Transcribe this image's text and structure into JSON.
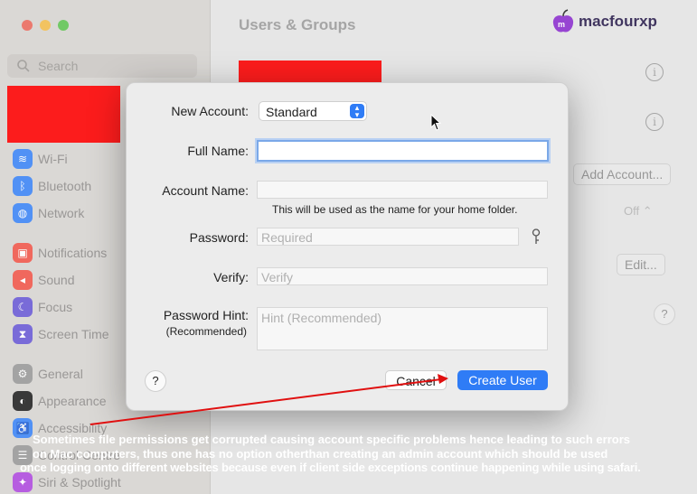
{
  "sidebar": {
    "search_placeholder": "Search",
    "items": [
      {
        "label": "Wi-Fi",
        "icon": "wifi-icon",
        "color": "#3d86f7"
      },
      {
        "label": "Bluetooth",
        "icon": "bluetooth-icon",
        "color": "#3d86f7"
      },
      {
        "label": "Network",
        "icon": "globe-icon",
        "color": "#3d86f7"
      },
      {
        "label": "Notifications",
        "icon": "bell-icon",
        "color": "#f2574a"
      },
      {
        "label": "Sound",
        "icon": "speaker-icon",
        "color": "#f2574a"
      },
      {
        "label": "Focus",
        "icon": "moon-icon",
        "color": "#6a5bd6"
      },
      {
        "label": "Screen Time",
        "icon": "hourglass-icon",
        "color": "#6a5bd6"
      },
      {
        "label": "General",
        "icon": "gear-icon",
        "color": "#9a9a9a"
      },
      {
        "label": "Appearance",
        "icon": "appearance-icon",
        "color": "#222222"
      },
      {
        "label": "Accessibility",
        "icon": "accessibility-icon",
        "color": "#3d86f7"
      },
      {
        "label": "Control Centre",
        "icon": "control-centre-icon",
        "color": "#9a9a9a"
      },
      {
        "label": "Siri & Spotlight",
        "icon": "siri-icon",
        "color": "#b04be0"
      }
    ]
  },
  "main": {
    "title": "Users & Groups",
    "add_account_label": "Add Account...",
    "off_label": "Off",
    "edit_label": "Edit...",
    "help_label": "?"
  },
  "brand": {
    "name": "macfourxp"
  },
  "sheet": {
    "new_account_label": "New Account:",
    "account_type": "Standard",
    "full_name_label": "Full Name:",
    "full_name_value": "",
    "account_name_label": "Account Name:",
    "account_name_value": "",
    "account_name_hint": "This will be used as the name for your home folder.",
    "password_label": "Password:",
    "password_placeholder": "Required",
    "verify_label": "Verify:",
    "verify_placeholder": "Verify",
    "password_hint_label": "Password Hint:",
    "password_hint_sublabel": "(Recommended)",
    "password_hint_placeholder": "Hint (Recommended)",
    "help_label": "?",
    "cancel_label": "Cancel",
    "create_label": "Create User"
  },
  "caption": {
    "line1": "Sometimes file permissions get corrupted causing account specific problems hence leading to such errors",
    "line2": "on Mac computers, thus one has no option otherthan creating an admin account which should be used",
    "line3": "once logging onto different websites because even if client side exceptions continue happening while using safari."
  },
  "colors": {
    "accent": "#2f7cf6",
    "redaction": "#ff0000",
    "annotation_arrow": "#e01010"
  }
}
